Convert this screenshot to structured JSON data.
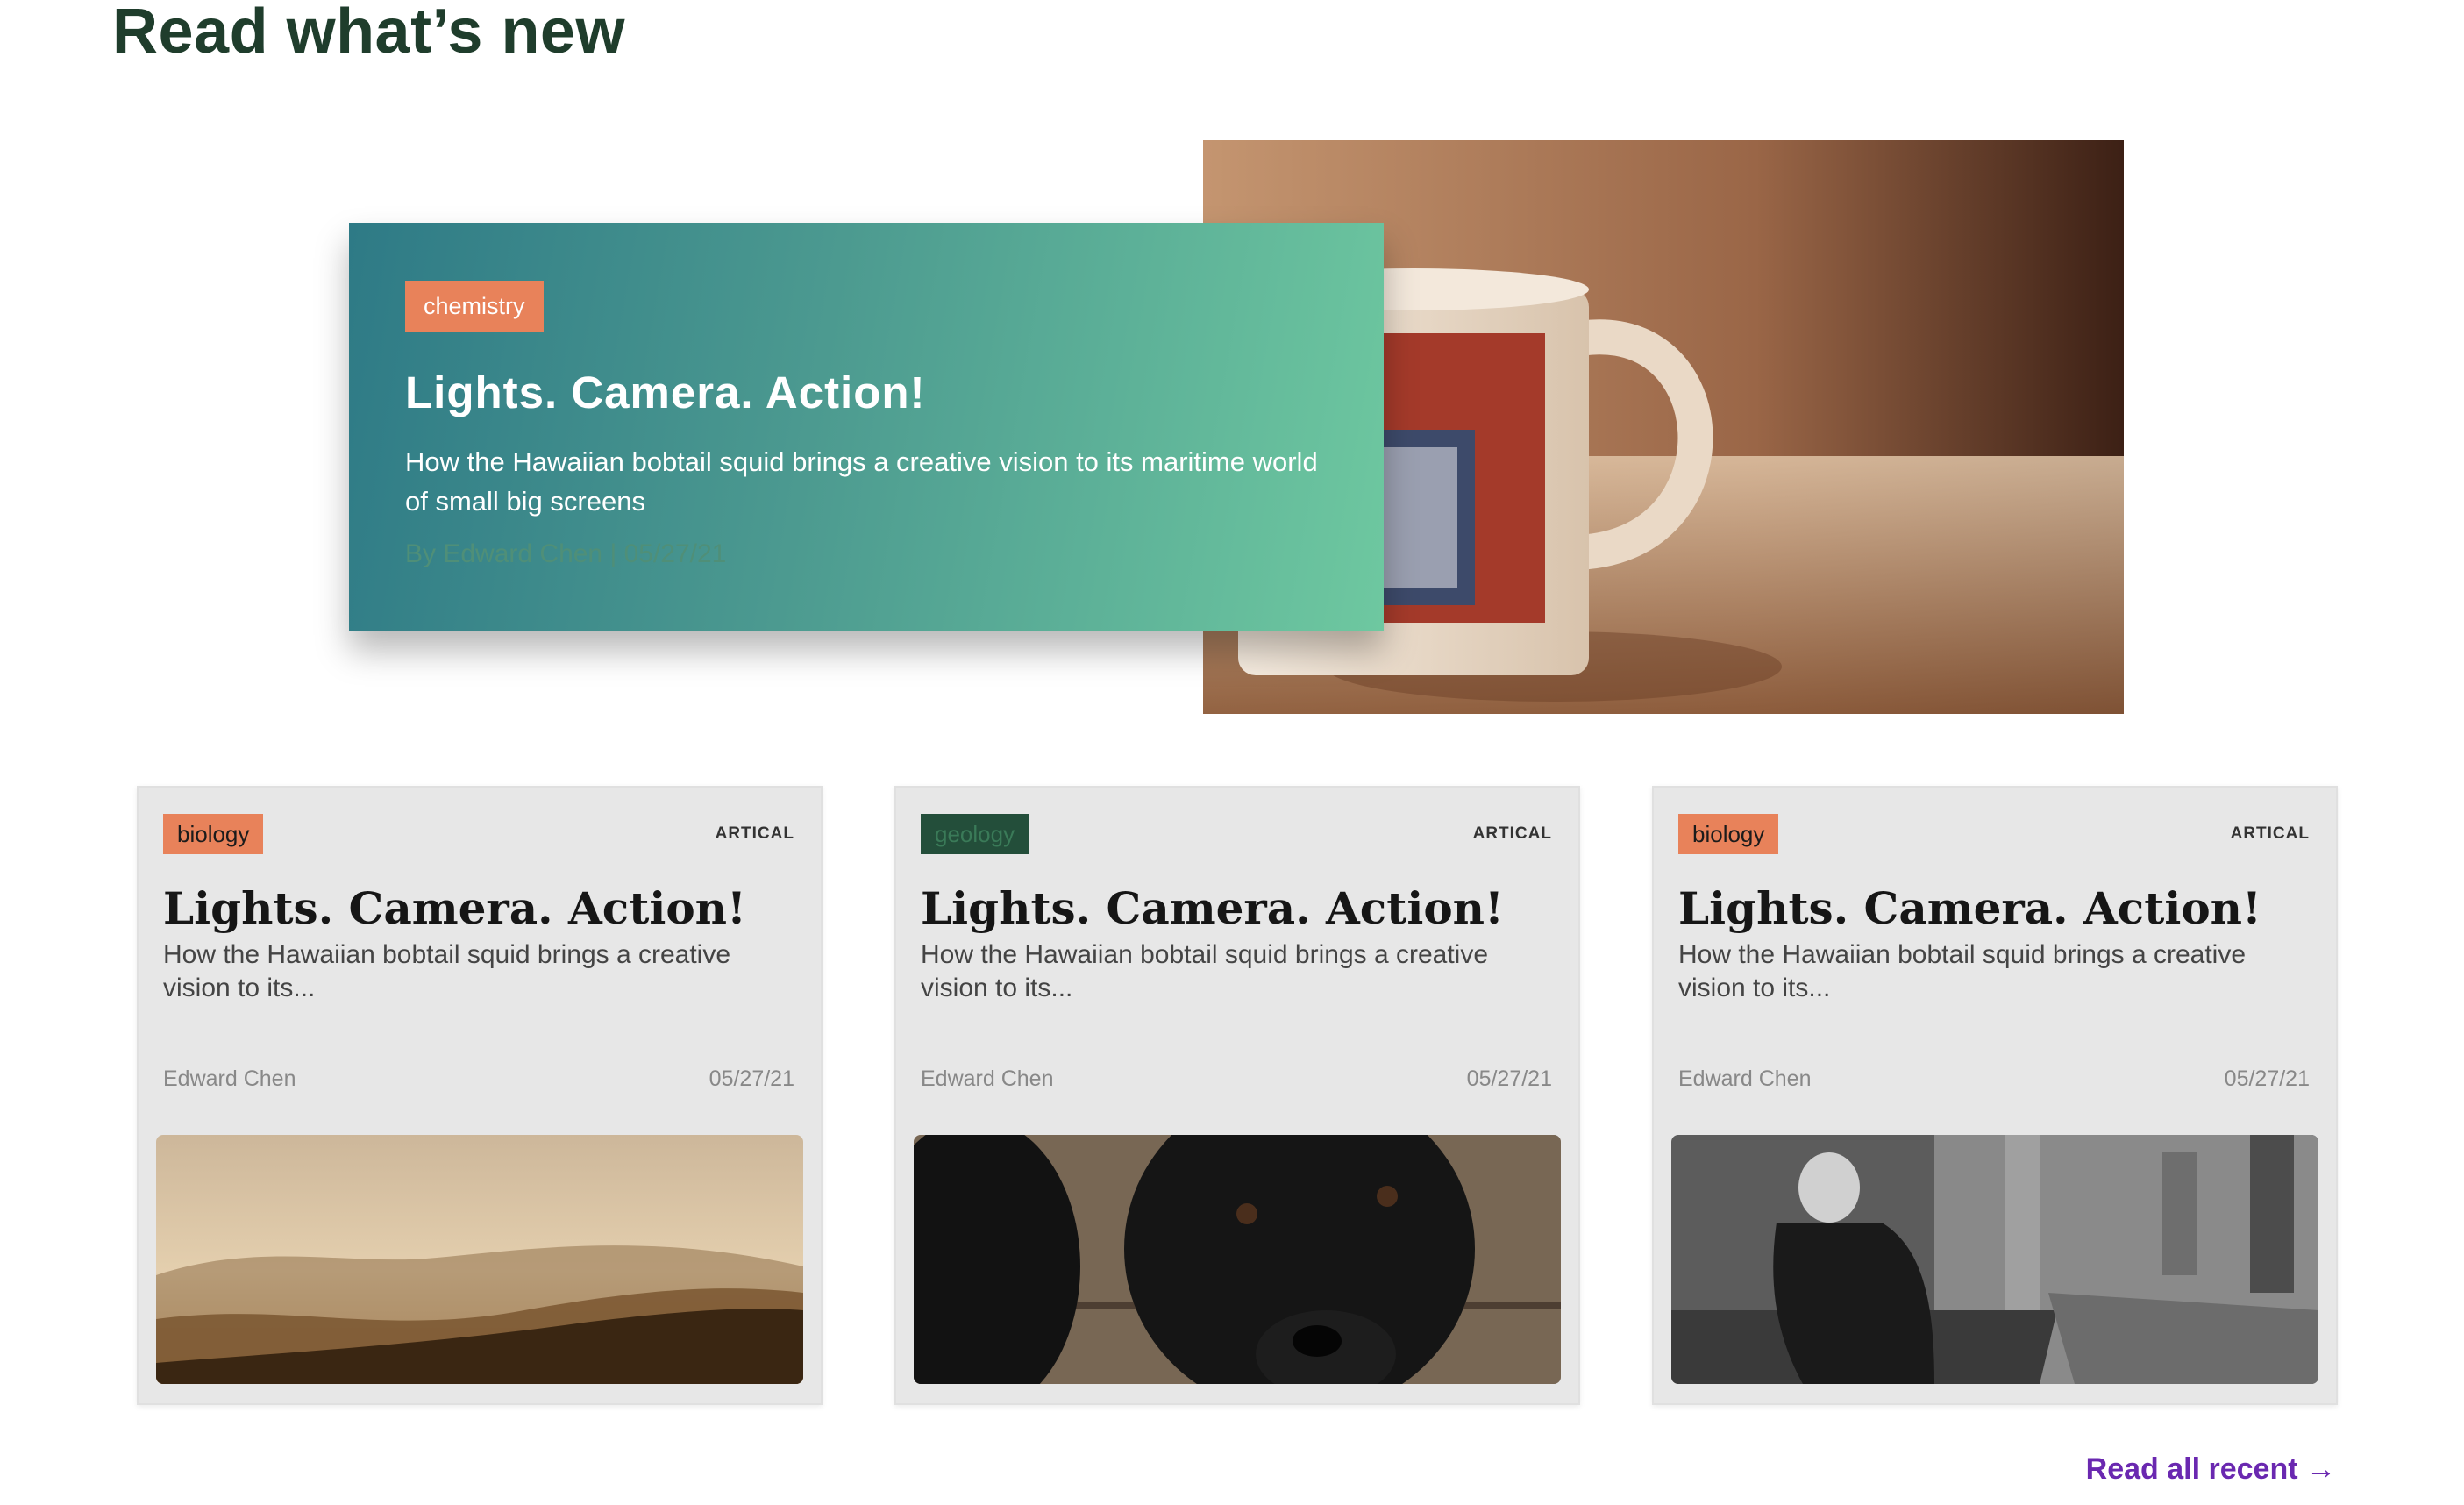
{
  "section": {
    "title": "Read what’s new"
  },
  "featured": {
    "tag": "chemistry",
    "headline": "Lights. Camera. Action!",
    "description": "How the Hawaiian bobtail squid brings a creative vision to its maritime world of small big screens",
    "byline": "By Edward Chen | 05/27/21",
    "image_icon": "coffee-mug-photo"
  },
  "cards": [
    {
      "tag": "biology",
      "type": "ARTICAL",
      "headline": "Lights. Camera. Action!",
      "excerpt": "How the Hawaiian bobtail squid brings a creative vision to its...",
      "author": "Edward Chen",
      "date": "05/27/21",
      "image_icon": "misty-hills-photo"
    },
    {
      "tag": "geology",
      "type": "ARTICAL",
      "headline": "Lights. Camera. Action!",
      "excerpt": "How the Hawaiian bobtail squid brings a creative vision to its...",
      "author": "Edward Chen",
      "date": "05/27/21",
      "image_icon": "black-puppy-photo"
    },
    {
      "tag": "biology",
      "type": "ARTICAL",
      "headline": "Lights. Camera. Action!",
      "excerpt": "How the Hawaiian bobtail squid brings a creative vision to its...",
      "author": "Edward Chen",
      "date": "05/27/21",
      "image_icon": "church-interior-photo"
    }
  ],
  "footer": {
    "read_all_label": "Read all recent →"
  },
  "colors": {
    "title": "#1f3d2c",
    "tag_orange": "#e8825a",
    "tag_green": "#234e3a",
    "link_purple": "#6a28b0",
    "card_bg": "#e7e7e7"
  }
}
